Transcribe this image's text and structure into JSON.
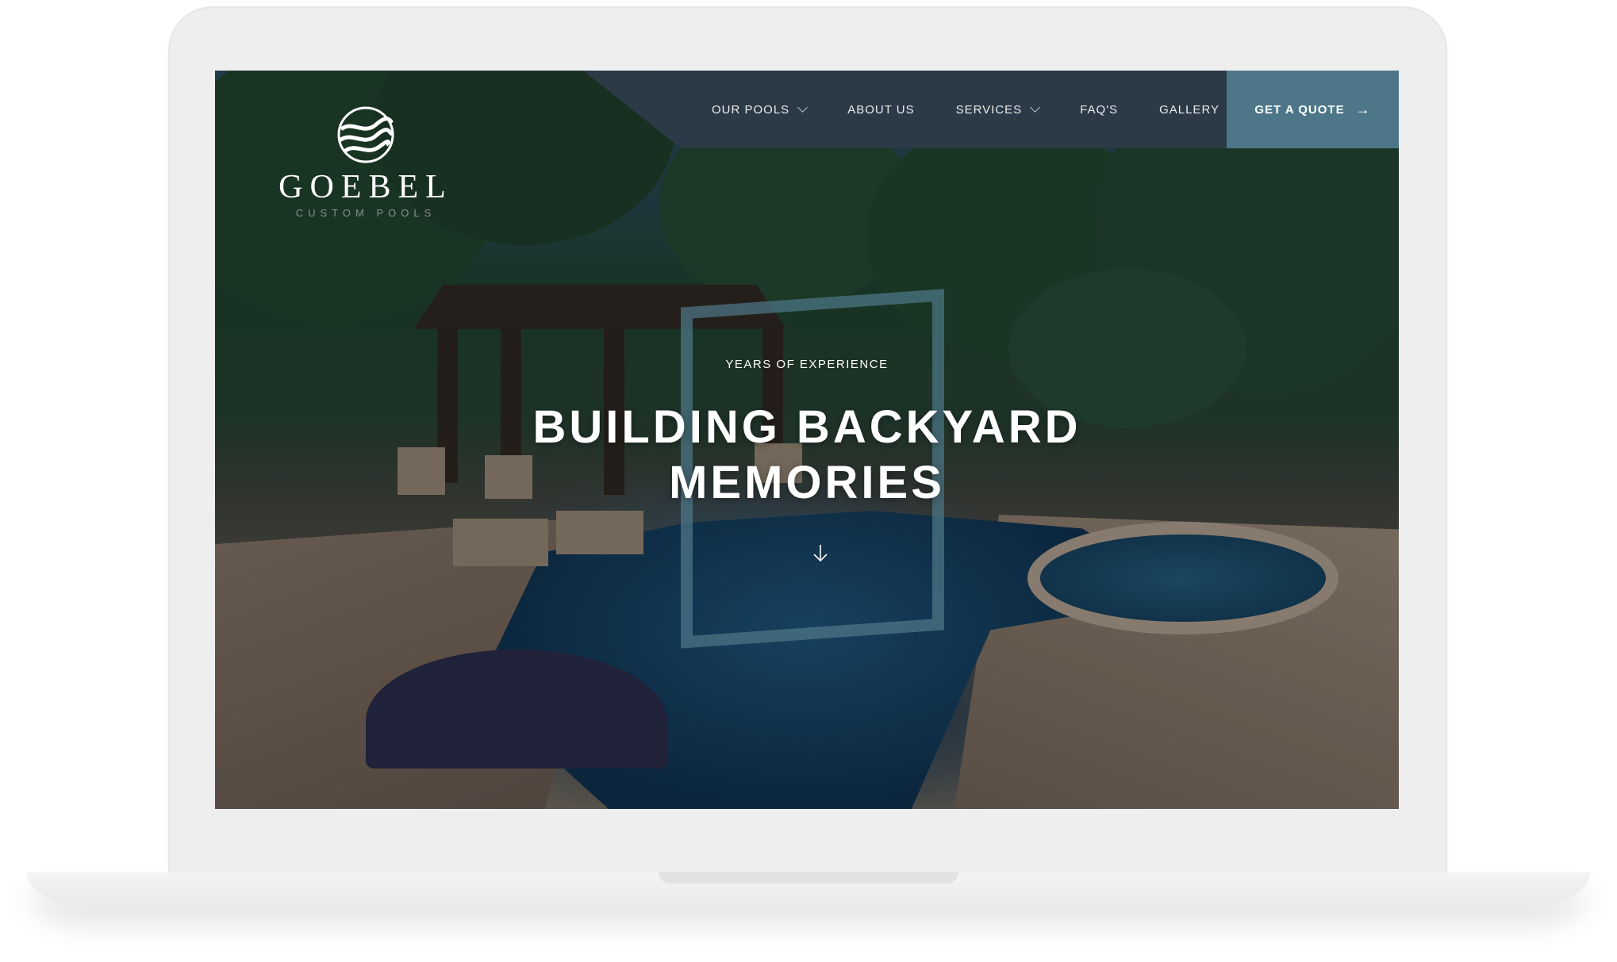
{
  "brand": {
    "name": "GOEBEL",
    "tagline": "CUSTOM POOLS"
  },
  "nav": {
    "items": [
      {
        "label": "OUR POOLS",
        "dropdown": true
      },
      {
        "label": "ABOUT US",
        "dropdown": false
      },
      {
        "label": "SERVICES",
        "dropdown": true
      },
      {
        "label": "FAQ'S",
        "dropdown": false
      },
      {
        "label": "GALLERY",
        "dropdown": false
      }
    ],
    "cta": {
      "label": "GET A QUOTE",
      "icon": "arrow-right-icon"
    }
  },
  "hero": {
    "eyebrow": "YEARS OF EXPERIENCE",
    "headline_line1": "BUILDING BACKYARD",
    "headline_line2": "MEMORIES",
    "scroll_icon": "arrow-down-icon",
    "image": "backyard pool with pavilion at dusk"
  },
  "colors": {
    "nav_bg": "#2d3a48",
    "cta_bg": "#4d7788",
    "frame": "#4d7788",
    "text": "#ffffff"
  }
}
